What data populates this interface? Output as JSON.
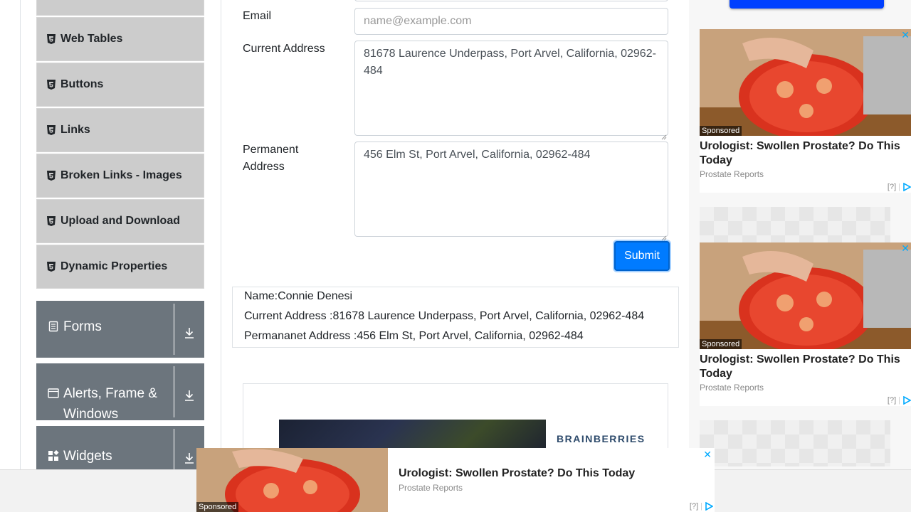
{
  "sidebar": {
    "items": [
      {
        "label": "Web Tables"
      },
      {
        "label": "Buttons"
      },
      {
        "label": "Links"
      },
      {
        "label": "Broken Links - Images"
      },
      {
        "label": "Upload and Download"
      },
      {
        "label": "Dynamic Properties"
      }
    ],
    "groups": [
      {
        "label": "Forms",
        "icon": "form-icon"
      },
      {
        "label": "Alerts, Frame & Windows",
        "icon": "window-icon"
      },
      {
        "label": "Widgets",
        "icon": "widgets-icon"
      }
    ]
  },
  "form": {
    "email_label": "Email",
    "email_placeholder": "name@example.com",
    "current_address_label": "Current Address",
    "current_address_value": "81678 Laurence Underpass, Port Arvel, California, 02962-484",
    "permanent_address_label": "Permanent Address",
    "permanent_address_value": "456 Elm St, Port Arvel, California, 02962-484",
    "submit_label": "Submit"
  },
  "output": {
    "name": "Name:Connie Denesi",
    "current_address": "Current Address :81678 Laurence Underpass, Port Arvel, California, 02962-484",
    "permanent_address": "Permananet Address :456 Elm St, Port Arvel, California, 02962-484"
  },
  "ads": {
    "brainberries": "BRAINBERRIES",
    "sponsored": "Sponsored",
    "title": "Urologist: Swollen Prostate? Do This Today",
    "source": "Prostate Reports",
    "help": "[?]",
    "close": "✕"
  },
  "colors": {
    "primary": "#007bff",
    "group_bg": "#6c757d",
    "menu_bg": "#cccccc"
  }
}
